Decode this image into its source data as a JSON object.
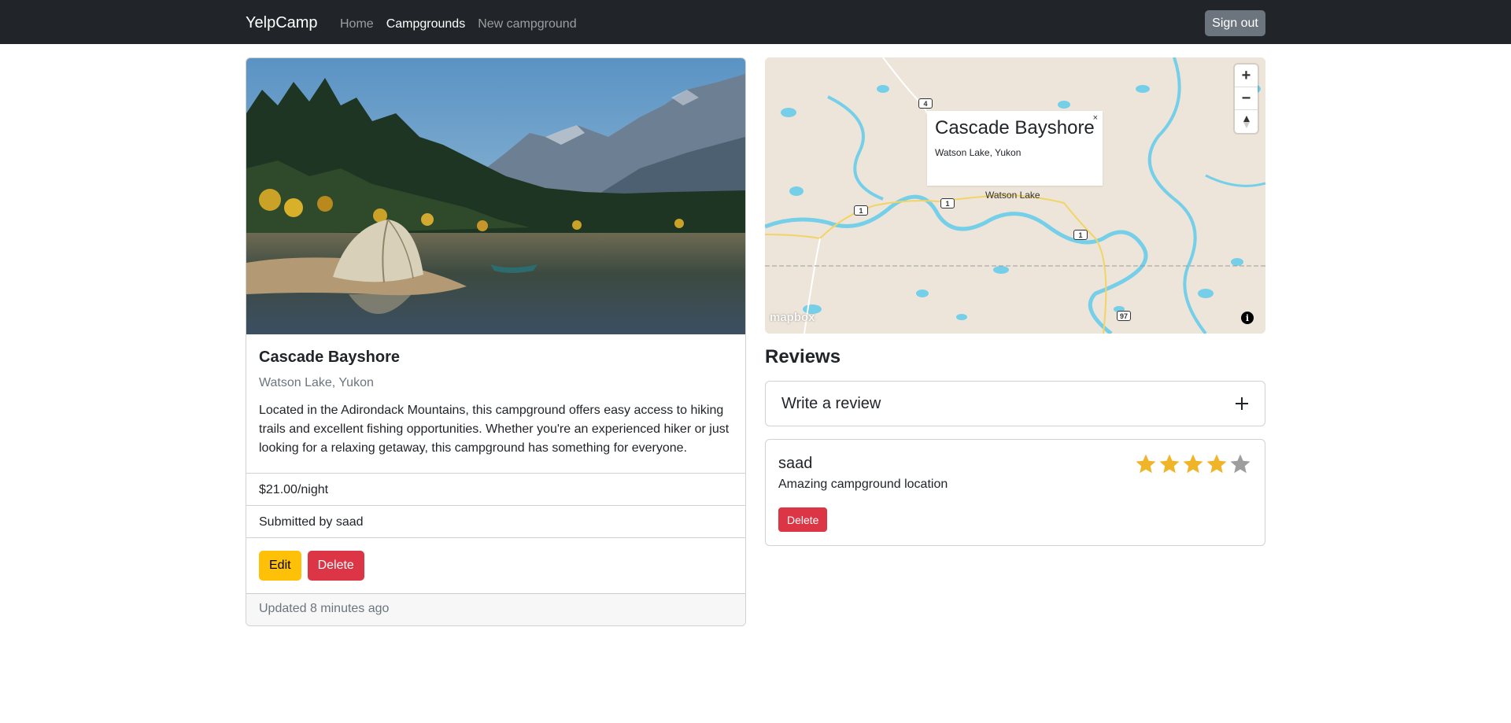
{
  "navbar": {
    "brand": "YelpCamp",
    "links": [
      {
        "label": "Home",
        "active": false
      },
      {
        "label": "Campgrounds",
        "active": true
      },
      {
        "label": "New campground",
        "active": false
      }
    ],
    "signout_label": "Sign out"
  },
  "campground": {
    "title": "Cascade Bayshore",
    "location": "Watson Lake, Yukon",
    "description": "Located in the Adirondack Mountains, this campground offers easy access to hiking trails and excellent fishing opportunities. Whether you're an experienced hiker or just looking for a relaxing getaway, this campground has something for everyone.",
    "price": "$21.00/night",
    "submitted_by": "Submitted by saad",
    "edit_label": "Edit",
    "delete_label": "Delete",
    "updated": "Updated 8 minutes ago"
  },
  "map": {
    "popup_title": "Cascade Bayshore",
    "popup_subtitle": "Watson Lake, Yukon",
    "popup_close": "×",
    "place_label": "Watson Lake",
    "highway_shields": [
      "4",
      "1",
      "1",
      "1",
      "97"
    ],
    "zoom_in": "+",
    "zoom_out": "−",
    "logo": "mapbox",
    "info": "i"
  },
  "reviews": {
    "title": "Reviews",
    "write_label": "Write a review",
    "expand_icon": "plus-icon",
    "items": [
      {
        "author": "saad",
        "text": "Amazing campground location",
        "rating": 4,
        "max_rating": 5,
        "delete_label": "Delete"
      }
    ]
  },
  "colors": {
    "navbar_bg": "#212529",
    "warning": "#ffc107",
    "danger": "#dc3545",
    "star_filled": "#f0b429",
    "star_empty": "#9e9e9e",
    "water": "#75cfe8",
    "land": "#ede5da"
  }
}
